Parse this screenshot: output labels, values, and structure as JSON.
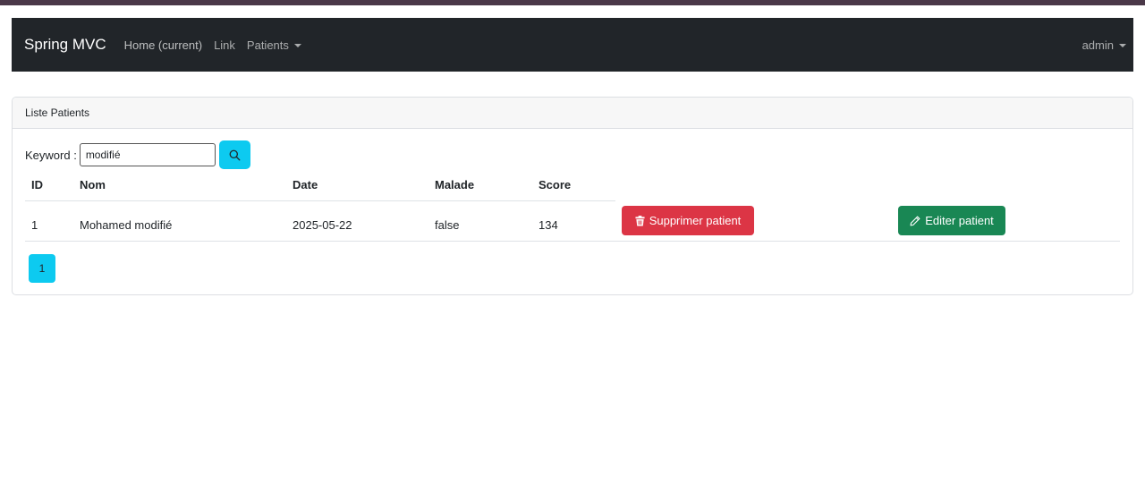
{
  "navbar": {
    "brand": "Spring MVC",
    "links": [
      {
        "label": "Home (current)"
      },
      {
        "label": "Link"
      },
      {
        "label": "Patients"
      }
    ],
    "user": "admin"
  },
  "card": {
    "title": "Liste Patients"
  },
  "search": {
    "label": "Keyword :",
    "value": "modifié",
    "icon": "search-icon"
  },
  "table": {
    "headers": [
      "ID",
      "Nom",
      "Date",
      "Malade",
      "Score"
    ],
    "rows": [
      {
        "id": "1",
        "nom": "Mohamed modifié",
        "date": "2025-05-22",
        "malade": "false",
        "score": "134",
        "delete_label": "Supprimer patient",
        "edit_label": "Editer patient"
      }
    ]
  },
  "pagination": {
    "pages": [
      "1"
    ],
    "current": 1
  },
  "colors": {
    "navbar": "#212529",
    "info": "#0dcaf0",
    "danger": "#dc3545",
    "success": "#198754"
  }
}
